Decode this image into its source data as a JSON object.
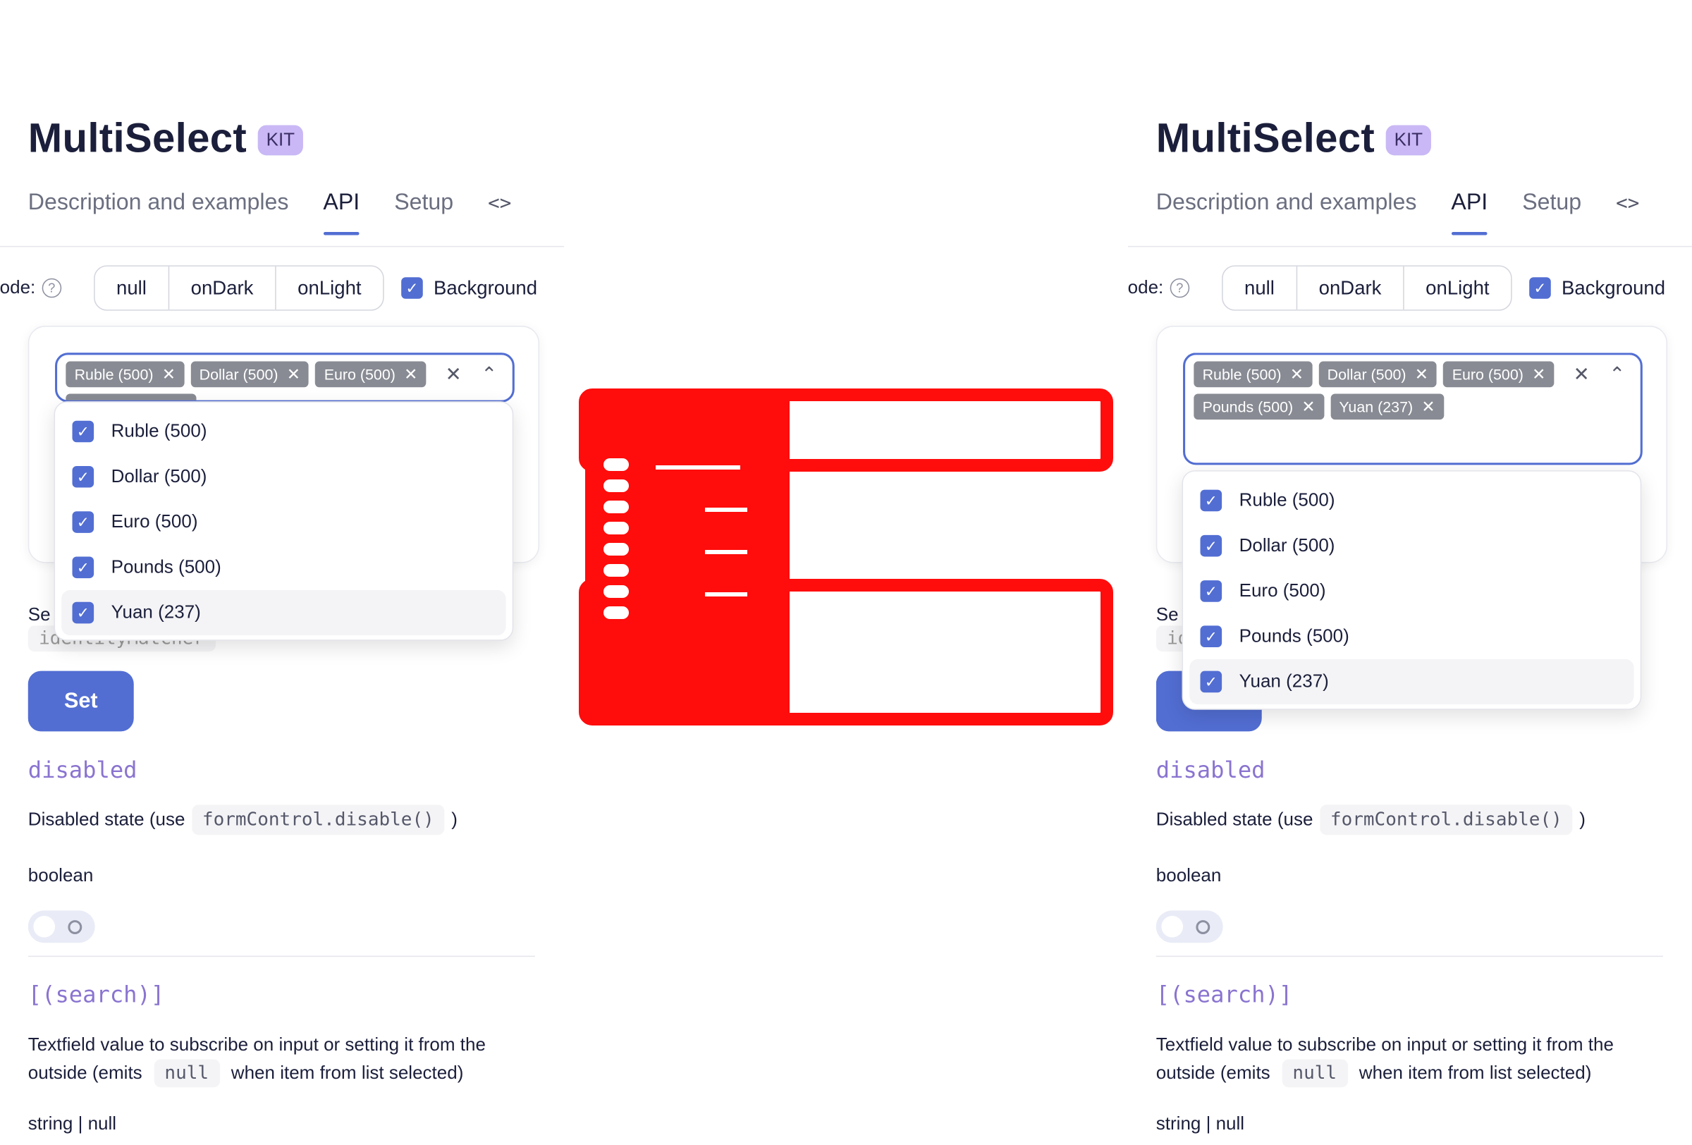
{
  "page": {
    "title": "MultiSelect",
    "kit_badge": "KIT",
    "tabs": [
      {
        "label": "Description and examples"
      },
      {
        "label": "API"
      },
      {
        "label": "Setup"
      }
    ],
    "code_icon": "<>",
    "mode_label": "lode:",
    "mode_options": [
      "null",
      "onDark",
      "onLight"
    ],
    "background_label": "Background",
    "set_label": "Se",
    "identity_value": "identityMatcher",
    "set_button": "Set",
    "disabled_prop": "disabled",
    "disabled_desc_before": "Disabled state (use",
    "disabled_desc_code": "formControl.disable()",
    "disabled_desc_after": ")",
    "disabled_type": "boolean",
    "search_prop": "[(search)]",
    "search_desc_line1": "Textfield value to subscribe on input or setting it from the",
    "search_desc_before": "outside (emits",
    "search_desc_code": "null",
    "search_desc_after": "when item from list selected)",
    "search_type": "string | null"
  },
  "multiselect": {
    "chips": [
      {
        "label": "Ruble (500)"
      },
      {
        "label": "Dollar (500)"
      },
      {
        "label": "Euro (500)"
      },
      {
        "label": "Pounds (500)"
      },
      {
        "label": "Yuan (237)"
      }
    ],
    "clear_icon": "×",
    "collapse_icon": "⌃",
    "options": [
      {
        "label": "Ruble (500)",
        "checked": true
      },
      {
        "label": "Dollar (500)",
        "checked": true
      },
      {
        "label": "Euro (500)",
        "checked": true
      },
      {
        "label": "Pounds (500)",
        "checked": true
      },
      {
        "label": "Yuan (237)",
        "checked": true
      }
    ]
  },
  "colors": {
    "accent": "#526ed3",
    "prop_name": "#8a74d0",
    "chip": "#888b93",
    "kit_badge": "#c9b8f5",
    "diff_overlay": "#ff0000"
  }
}
